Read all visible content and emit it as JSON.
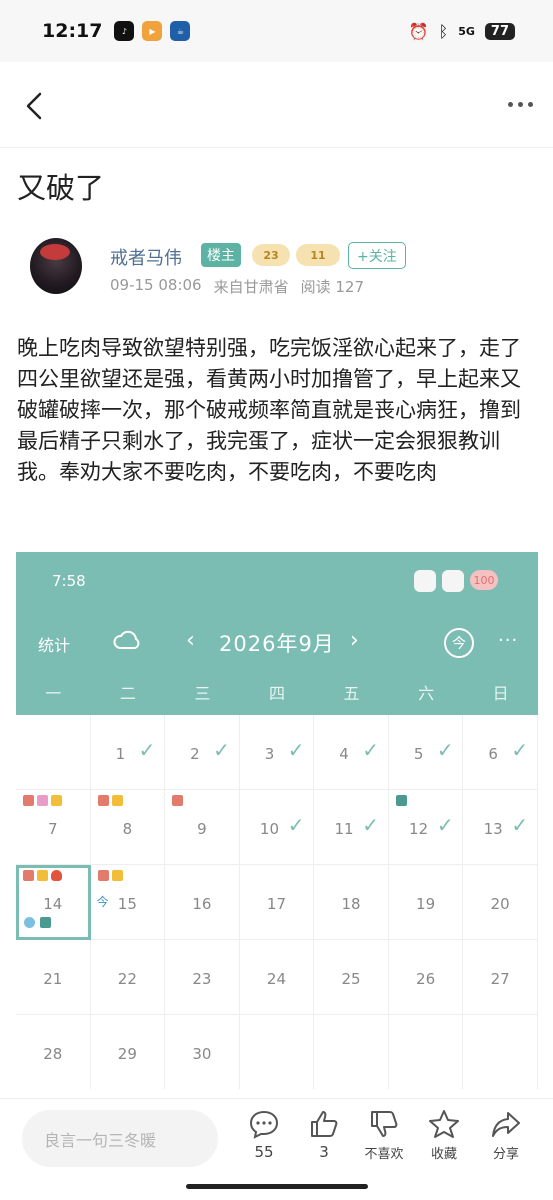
{
  "status_bar": {
    "time": "12:17",
    "apps": [
      "TikTok",
      "Bilibili",
      "瑞幸"
    ],
    "signal": "5G",
    "battery": "77"
  },
  "nav": {
    "back_icon": "chevron-left-icon",
    "more_icon": "more-dots-icon"
  },
  "post": {
    "title": "又破了",
    "author": "戒者马伟",
    "owner_badge": "楼主",
    "level_badge_1": "23",
    "level_badge_2": "11",
    "follow_label": "+关注",
    "date": "09-15 08:06",
    "location": "来自甘肃省",
    "reads": "阅读 127",
    "body": "晚上吃肉导致欲望特别强，吃完饭淫欲心起来了，走了四公里欲望还是强，看黄两小时加撸管了，早上起来又破罐破摔一次，那个破戒频率简直就是丧心病狂，撸到最后精子只剩水了，我完蛋了，症状一定会狠狠教训我。奉劝大家不要吃肉，不要吃肉，不要吃肉"
  },
  "calendar": {
    "time": "7:58",
    "badge_100": "100",
    "stats_label": "统计",
    "prev": "‹",
    "month": "2026年9月",
    "next": "›",
    "today_label": "今",
    "more": "···",
    "weekdays": [
      "一",
      "二",
      "三",
      "四",
      "五",
      "六",
      "日"
    ],
    "jin_label": "今",
    "days": [
      {
        "num": ""
      },
      {
        "num": "1",
        "check": true
      },
      {
        "num": "2",
        "check": true
      },
      {
        "num": "3",
        "check": true
      },
      {
        "num": "4",
        "check": true
      },
      {
        "num": "5",
        "check": true
      },
      {
        "num": "6",
        "check": true
      },
      {
        "num": "7"
      },
      {
        "num": "8"
      },
      {
        "num": "9"
      },
      {
        "num": "10",
        "check": true
      },
      {
        "num": "11",
        "check": true
      },
      {
        "num": "12",
        "check": true
      },
      {
        "num": "13",
        "check": true
      },
      {
        "num": "14",
        "selected": true
      },
      {
        "num": "15",
        "today": true
      },
      {
        "num": "16"
      },
      {
        "num": "17"
      },
      {
        "num": "18"
      },
      {
        "num": "19"
      },
      {
        "num": "20"
      },
      {
        "num": "21"
      },
      {
        "num": "22"
      },
      {
        "num": "23"
      },
      {
        "num": "24"
      },
      {
        "num": "25"
      },
      {
        "num": "26"
      },
      {
        "num": "27"
      },
      {
        "num": "28"
      },
      {
        "num": "29"
      },
      {
        "num": "30"
      },
      {
        "num": ""
      },
      {
        "num": ""
      },
      {
        "num": ""
      },
      {
        "num": ""
      }
    ]
  },
  "bottom_bar": {
    "reply_placeholder": "良言一句三冬暖",
    "comments": "55",
    "likes": "3",
    "dislike_label": "不喜欢",
    "favorite_label": "收藏",
    "share_label": "分享"
  },
  "colors": {
    "accent": "#5cb3a4",
    "calendar_header": "#7bbdb3",
    "link": "#4f6f93"
  }
}
